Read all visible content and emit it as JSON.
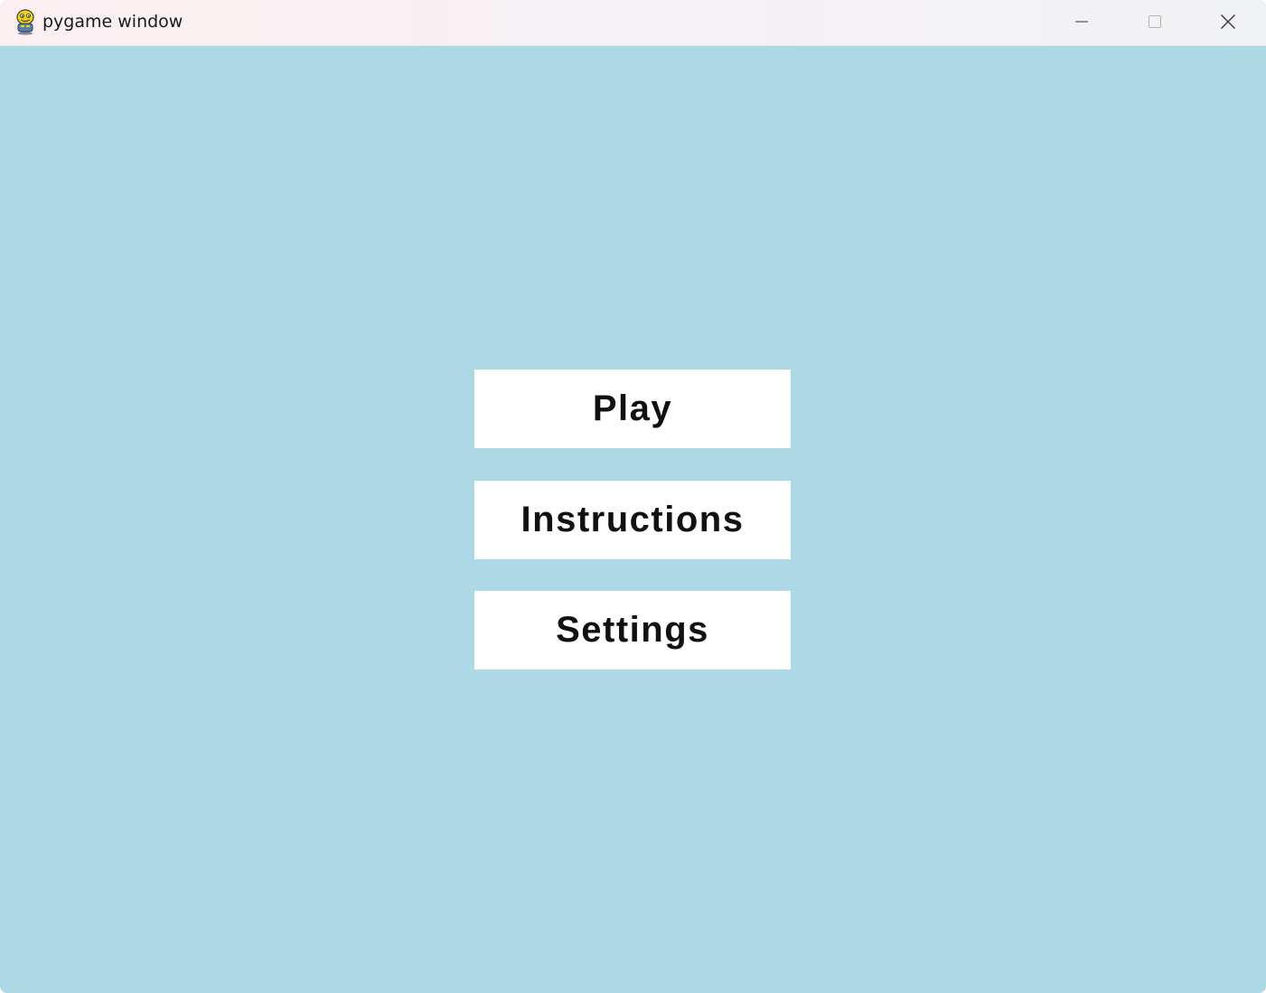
{
  "window": {
    "title": "pygame window",
    "icon": "pygame-snake-icon",
    "controls": {
      "minimize_icon": "minimize-icon",
      "maximize_icon": "maximize-icon",
      "close_icon": "close-icon"
    }
  },
  "menu": {
    "background_color": "#add8e6",
    "button_color": "#ffffff",
    "text_color": "#111111",
    "buttons": [
      {
        "label": "Play"
      },
      {
        "label": "Instructions"
      },
      {
        "label": "Settings"
      }
    ]
  }
}
